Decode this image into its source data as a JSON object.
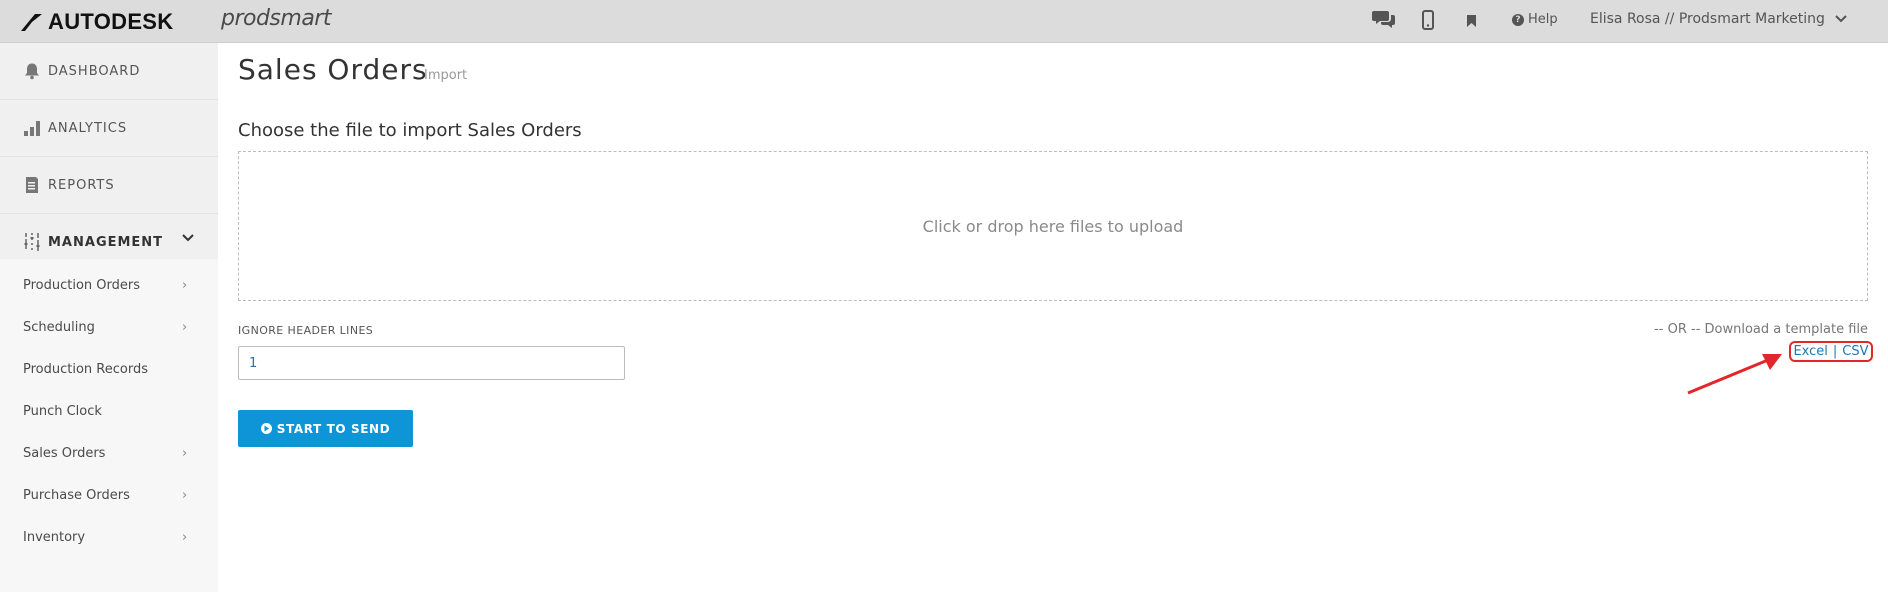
{
  "header": {
    "brand": "AUTODESK",
    "product": "prodsmart",
    "icons": [
      "chat-icon",
      "mobile-icon",
      "bookmark-icon"
    ],
    "help_label": "Help",
    "user_label": "Elisa Rosa // Prodsmart Marketing"
  },
  "sidebar": {
    "main_items": [
      {
        "label": "DASHBOARD",
        "icon": "bell-icon"
      },
      {
        "label": "ANALYTICS",
        "icon": "bar-chart-icon"
      },
      {
        "label": "REPORTS",
        "icon": "report-icon"
      },
      {
        "label": "MANAGEMENT",
        "icon": "sliders-icon"
      }
    ],
    "management_items": [
      {
        "label": "Production Orders",
        "has_chevron": true
      },
      {
        "label": "Scheduling",
        "has_chevron": true
      },
      {
        "label": "Production Records",
        "has_chevron": false
      },
      {
        "label": "Punch Clock",
        "has_chevron": false
      },
      {
        "label": "Sales Orders",
        "has_chevron": true
      },
      {
        "label": "Purchase Orders",
        "has_chevron": true
      },
      {
        "label": "Inventory",
        "has_chevron": true
      }
    ]
  },
  "main": {
    "title": "Sales Orders",
    "subtitle": "Import",
    "choose_label": "Choose the file to import Sales Orders",
    "dropzone_text": "Click or drop here files to upload",
    "ignore_label": "IGNORE HEADER LINES",
    "ignore_value": "1",
    "template_text": "-- OR -- Download a template file",
    "excel_link": "Excel",
    "link_separator": "|",
    "csv_link": "CSV",
    "send_button": "START TO SEND"
  },
  "colors": {
    "topbar": "#dcdcdc",
    "sidebar": "#f0f0f0",
    "accent_button": "#0d95d8",
    "link": "#1f77b4",
    "annotation": "#e2262b"
  }
}
